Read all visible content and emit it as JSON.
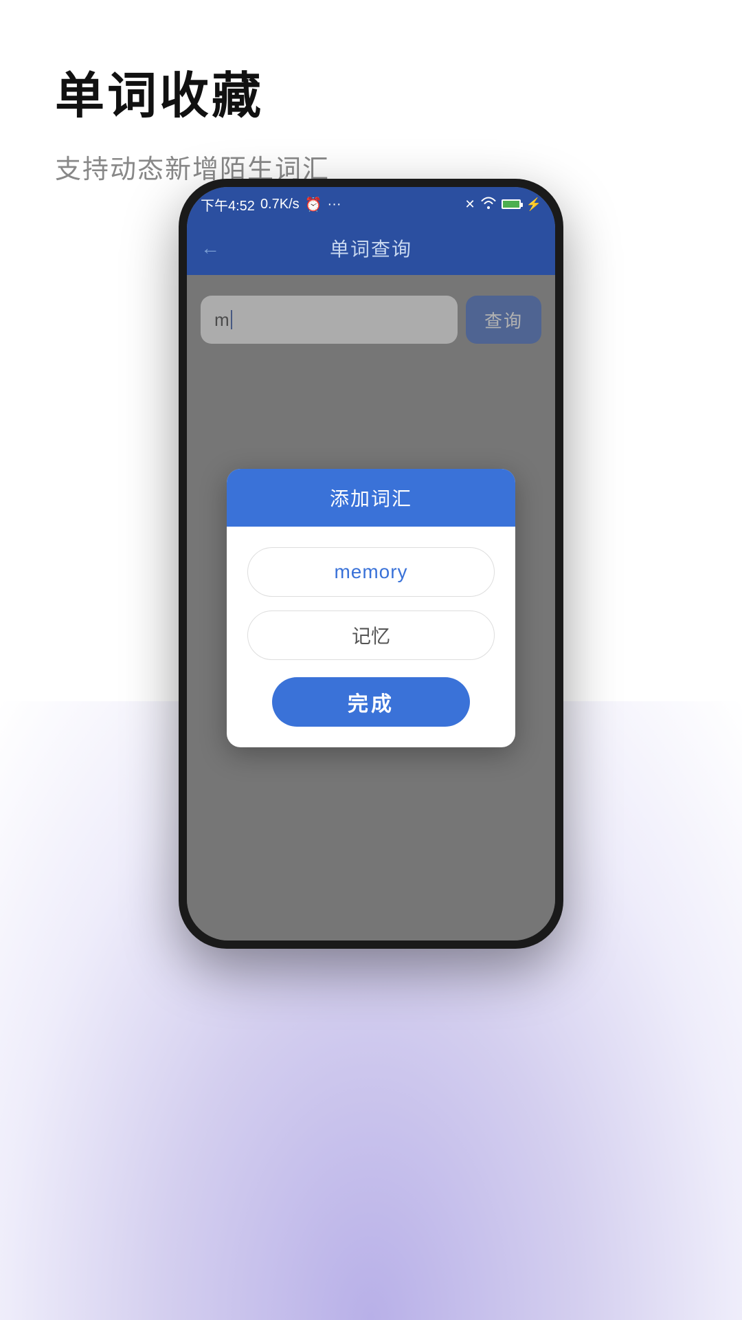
{
  "page": {
    "title": "单词收藏",
    "subtitle": "支持动态新增陌生词汇"
  },
  "status_bar": {
    "time": "下午4:52",
    "network": "0.7K/s",
    "alarm_icon": "⏰",
    "more_icon": "···"
  },
  "top_bar": {
    "back_icon": "←",
    "title": "单词查询"
  },
  "search": {
    "input_value": "m",
    "button_label": "查询"
  },
  "dialog": {
    "title": "添加词汇",
    "word_field": "memory",
    "translation_field": "记忆",
    "confirm_button": "完成"
  }
}
